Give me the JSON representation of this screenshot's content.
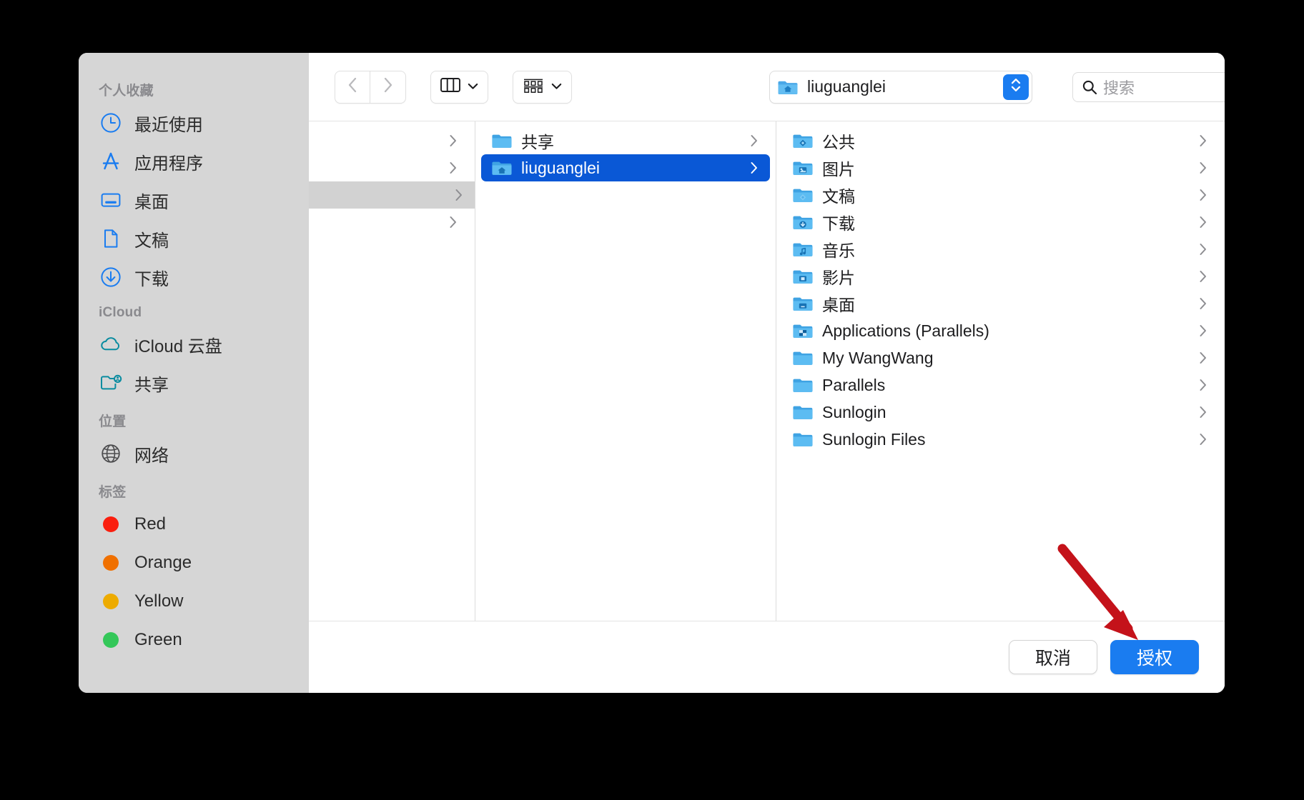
{
  "window": {
    "title": "liuguanglei"
  },
  "colors": {
    "accent": "#1a7cf0",
    "selection": "#0a58d6",
    "sidebar_bg": "#d6d6d6",
    "arrow": "#c4121a",
    "tag_red": "#fa1e0e",
    "tag_orange": "#f07000",
    "tag_yellow": "#edab00",
    "tag_green": "#34c759",
    "icloud_icon": "#0a8ca0"
  },
  "sidebar": {
    "groups": [
      {
        "title": "个人收藏",
        "items": [
          {
            "label": "最近使用",
            "icon": "clock-icon"
          },
          {
            "label": "应用程序",
            "icon": "appstore-icon"
          },
          {
            "label": "桌面",
            "icon": "desktop-icon"
          },
          {
            "label": "文稿",
            "icon": "document-icon"
          },
          {
            "label": "下载",
            "icon": "download-icon"
          }
        ]
      },
      {
        "title": "iCloud",
        "items": [
          {
            "label": "iCloud 云盘",
            "icon": "cloud-icon"
          },
          {
            "label": "共享",
            "icon": "shared-folder-icon"
          }
        ]
      },
      {
        "title": "位置",
        "items": [
          {
            "label": "网络",
            "icon": "globe-icon"
          }
        ]
      },
      {
        "title": "标签",
        "items": [
          {
            "label": "Red",
            "icon": "tag-dot-icon",
            "color": "#fa1e0e"
          },
          {
            "label": "Orange",
            "icon": "tag-dot-icon",
            "color": "#f07000"
          },
          {
            "label": "Yellow",
            "icon": "tag-dot-icon",
            "color": "#edab00"
          },
          {
            "label": "Green",
            "icon": "tag-dot-icon",
            "color": "#34c759"
          }
        ]
      }
    ]
  },
  "toolbar": {
    "back_icon": "chevron-left-icon",
    "forward_icon": "chevron-right-icon",
    "view_columns_icon": "column-view-icon",
    "group_icon": "group-by-icon",
    "dropdown_icon": "chevron-down-icon",
    "path_label": "liuguanglei",
    "path_icon": "home-folder-icon",
    "stepper_icon": "stepper-updown-icon",
    "search_placeholder": "搜索",
    "search_icon": "search-icon"
  },
  "columns": {
    "column1": {
      "rows": [
        {
          "label": "",
          "chevron": true,
          "state": "none"
        },
        {
          "label": "",
          "chevron": true,
          "state": "none"
        },
        {
          "label": "",
          "chevron": true,
          "state": "inactive-selected"
        },
        {
          "label": "",
          "chevron": true,
          "state": "none"
        }
      ]
    },
    "column2": {
      "rows": [
        {
          "label": "共享",
          "icon": "folder-icon",
          "chevron": true,
          "state": "none"
        },
        {
          "label": "liuguanglei",
          "icon": "home-folder-icon",
          "chevron": true,
          "state": "selected"
        }
      ]
    },
    "column3": {
      "rows": [
        {
          "label": "公共",
          "icon": "folder-public-icon",
          "chevron": true
        },
        {
          "label": "图片",
          "icon": "folder-pictures-icon",
          "chevron": true
        },
        {
          "label": "文稿",
          "icon": "folder-documents-icon",
          "chevron": true
        },
        {
          "label": "下载",
          "icon": "folder-downloads-icon",
          "chevron": true
        },
        {
          "label": "音乐",
          "icon": "folder-music-icon",
          "chevron": true
        },
        {
          "label": "影片",
          "icon": "folder-movies-icon",
          "chevron": true
        },
        {
          "label": "桌面",
          "icon": "folder-desktop-icon",
          "chevron": true
        },
        {
          "label": "Applications (Parallels)",
          "icon": "folder-apps-icon",
          "chevron": true
        },
        {
          "label": "My WangWang",
          "icon": "folder-icon",
          "chevron": true
        },
        {
          "label": "Parallels",
          "icon": "folder-icon",
          "chevron": true
        },
        {
          "label": "Sunlogin",
          "icon": "folder-icon",
          "chevron": true
        },
        {
          "label": "Sunlogin Files",
          "icon": "folder-icon",
          "chevron": true
        }
      ]
    }
  },
  "footer": {
    "cancel_label": "取消",
    "authorize_label": "授权"
  },
  "annotation": {
    "arrow_icon": "red-arrow-down-right-icon",
    "points_to": "授权"
  }
}
